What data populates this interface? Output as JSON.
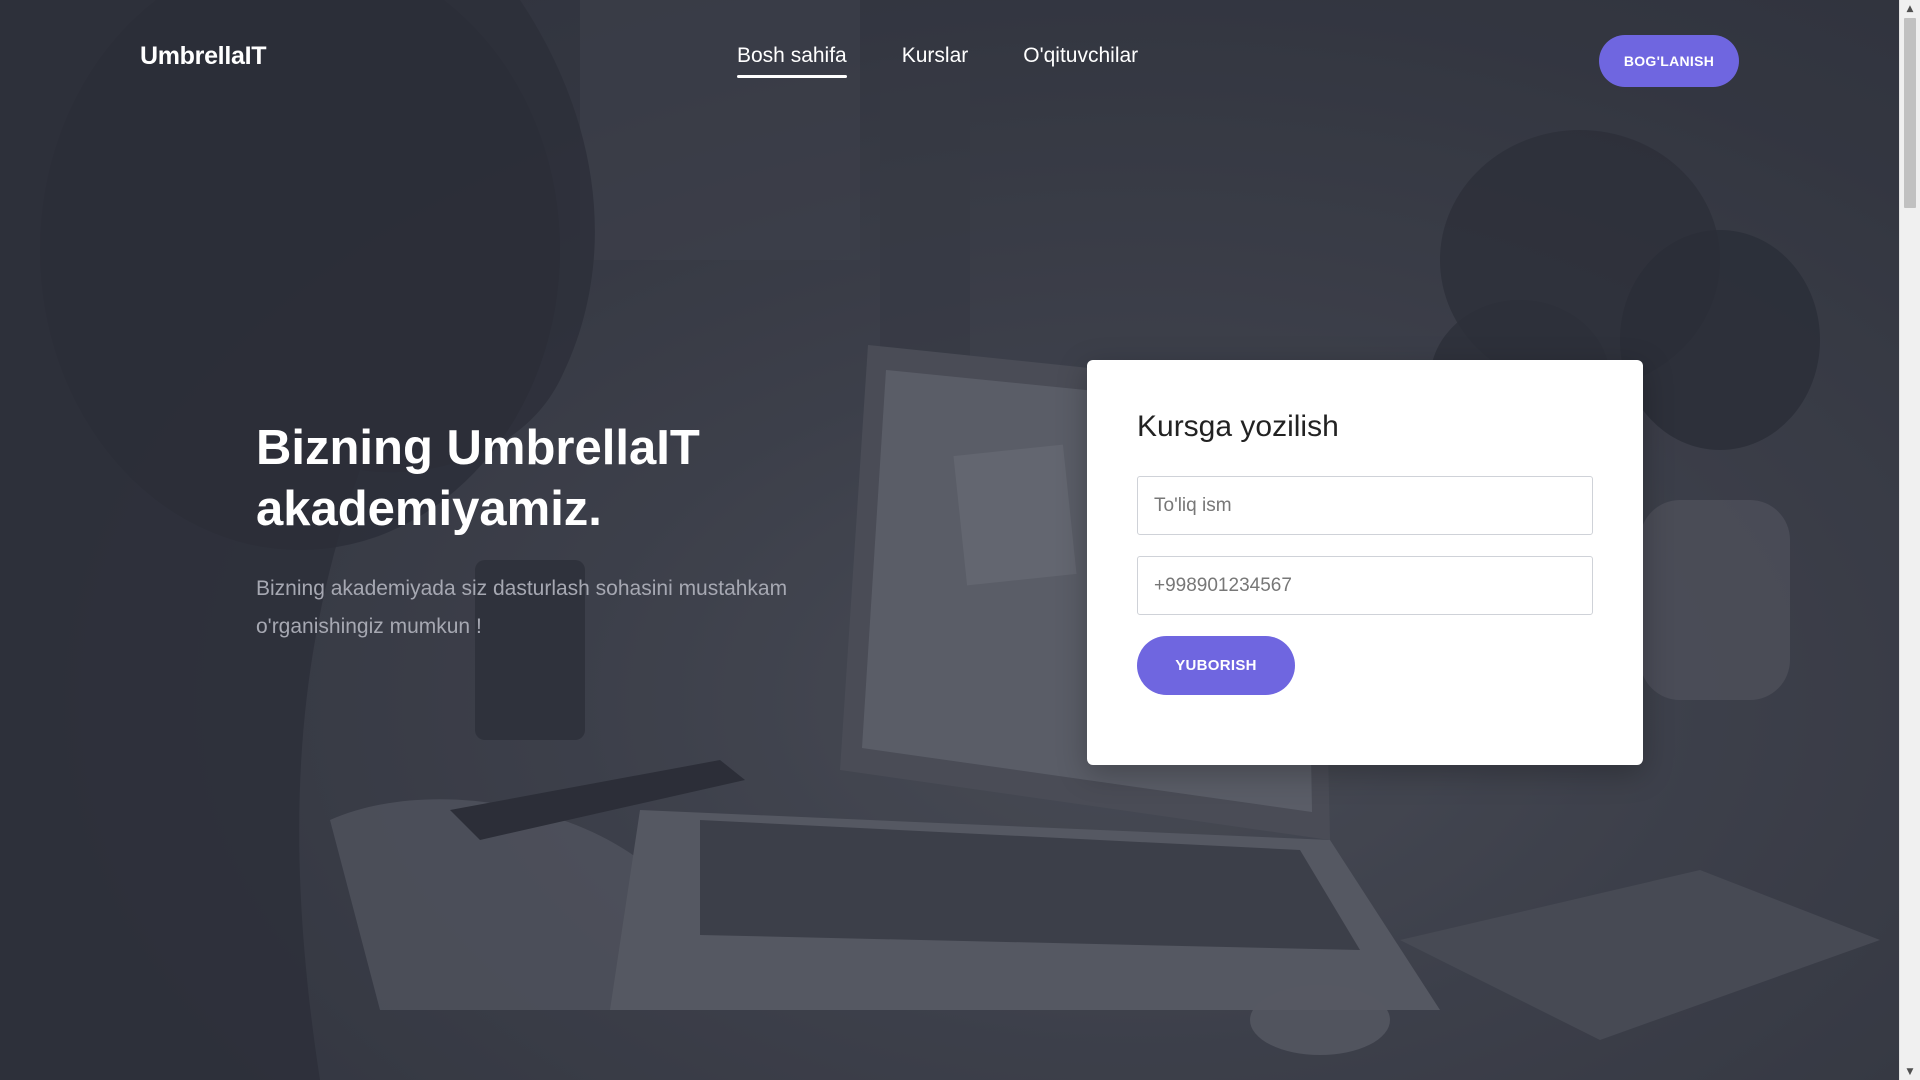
{
  "header": {
    "logo": "UmbrellaIT",
    "nav": [
      {
        "label": "Bosh sahifa",
        "active": true
      },
      {
        "label": "Kurslar",
        "active": false
      },
      {
        "label": "O'qituvchilar",
        "active": false
      }
    ],
    "contact_label": "BOG'LANISH"
  },
  "hero": {
    "title_line1": "Bizning UmbrellaIT",
    "title_line2": "akademiyamiz.",
    "subtitle_line1": "Bizning akademiyada siz dasturlash sohasini mustahkam",
    "subtitle_line2": "o'rganishingiz mumkun !"
  },
  "form": {
    "title": "Kursga yozilish",
    "name_placeholder": "To'liq ism",
    "phone_placeholder": "+998901234567",
    "submit_label": "YUBORISH"
  },
  "colors": {
    "accent": "#6f66e0",
    "overlay": "#3c3f4a",
    "card": "#ffffff"
  }
}
